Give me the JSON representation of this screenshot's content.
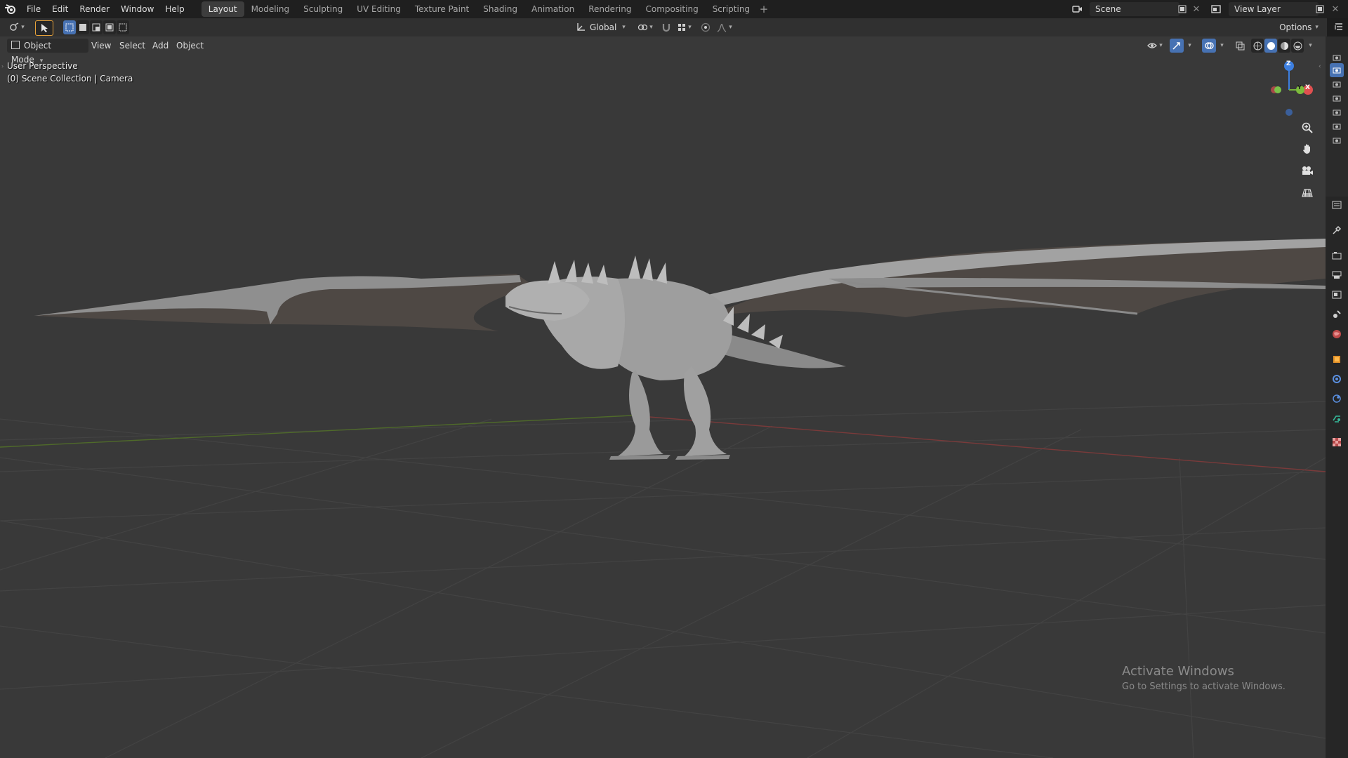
{
  "topbar": {
    "menus": [
      "File",
      "Edit",
      "Render",
      "Window",
      "Help"
    ],
    "workspaces": [
      "Layout",
      "Modeling",
      "Sculpting",
      "UV Editing",
      "Texture Paint",
      "Shading",
      "Animation",
      "Rendering",
      "Compositing",
      "Scripting"
    ],
    "active_workspace": "Layout",
    "add_workspace": "+",
    "scene_name": "Scene",
    "view_layer_name": "View Layer"
  },
  "toolbar": {
    "transform_orientation": "Global",
    "options_label": "Options"
  },
  "viewport_header": {
    "mode": "Object Mode",
    "menus": [
      "View",
      "Select",
      "Add",
      "Object"
    ]
  },
  "viewport": {
    "view_name": "User Perspective",
    "collection_info": "(0) Scene Collection | Camera",
    "gizmo": {
      "x": "X",
      "y": "Y",
      "z": "Z"
    },
    "watermark_title": "Activate Windows",
    "watermark_sub": "Go to Settings to activate Windows.",
    "colors": {
      "background": "#393939",
      "grid": "#444444",
      "x_axis": "#7a3a3a",
      "y_axis": "#4f6a2a",
      "model": "#a9a9a9"
    }
  },
  "icons": {
    "topbar": [
      "blender-logo-icon",
      "scene-icon",
      "new-scene-icon",
      "remove-scene-icon",
      "view-layer-icon",
      "new-view-layer-icon",
      "remove-view-layer-icon"
    ],
    "toolbar": [
      "editor-type-icon",
      "select-box-icon",
      "mode-set-new-icon",
      "mode-extend-icon",
      "mode-subtract-icon",
      "mode-intersect-icon",
      "mode-invert-icon",
      "transform-orientation-icon",
      "pivot-icon",
      "snap-icon",
      "snap-increment-icon",
      "proportional-edit-icon",
      "proportional-falloff-icon",
      "outliner-toggle-icon"
    ],
    "viewport": [
      "visibility-icon",
      "gizmo-icon",
      "overlay-icon",
      "xray-icon",
      "wireframe-shading-icon",
      "solid-shading-icon",
      "material-shading-icon",
      "rendered-shading-icon"
    ],
    "navigation": [
      "zoom-icon",
      "pan-hand-icon",
      "camera-view-icon",
      "grid-view-icon"
    ],
    "properties": [
      "tool-icon",
      "render-icon",
      "output-icon",
      "view-layer-props-icon",
      "scene-props-icon",
      "world-icon",
      "object-icon",
      "modifier-icon",
      "physics-icon",
      "constraint-icon",
      "data-icon",
      "texture-icon"
    ]
  }
}
